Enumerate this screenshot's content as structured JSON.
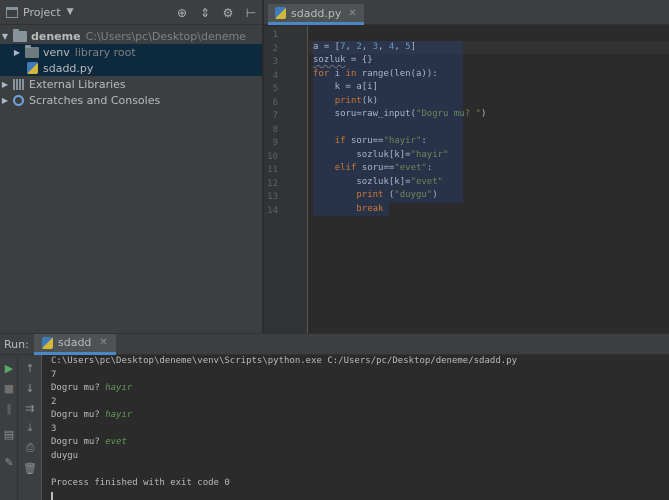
{
  "project_pane": {
    "title": "Project",
    "tree": {
      "root_name": "deneme",
      "root_path": "C:\\Users\\pc\\Desktop\\deneme",
      "venv_name": "venv",
      "venv_hint": "library root",
      "file_name": "sdadd.py",
      "external_libraries": "External Libraries",
      "scratches": "Scratches and Consoles"
    }
  },
  "editor": {
    "tab_label": "sdadd.py",
    "line_numbers": [
      "1",
      "2",
      "3",
      "4",
      "5",
      "6",
      "7",
      "8",
      "9",
      "10",
      "11",
      "12",
      "13",
      "14"
    ]
  },
  "run_window": {
    "label": "Run:",
    "tab_label": "sdadd",
    "console": {
      "command": "C:\\Users\\pc\\Desktop\\deneme\\venv\\Scripts\\python.exe C:/Users/pc/Desktop/deneme/sdadd.py",
      "out_1": "7",
      "prompt": "Dogru mu? ",
      "input_1": "hayır",
      "out_2": "2",
      "input_2": "hayır",
      "out_3": "3",
      "input_3": "evet",
      "out_4": "duygu",
      "finish": "Process finished with exit code 0"
    }
  },
  "colors": {
    "keyword": "#cc7832",
    "number": "#6897bb",
    "string": "#6a8759",
    "accent": "#4a88c7"
  }
}
